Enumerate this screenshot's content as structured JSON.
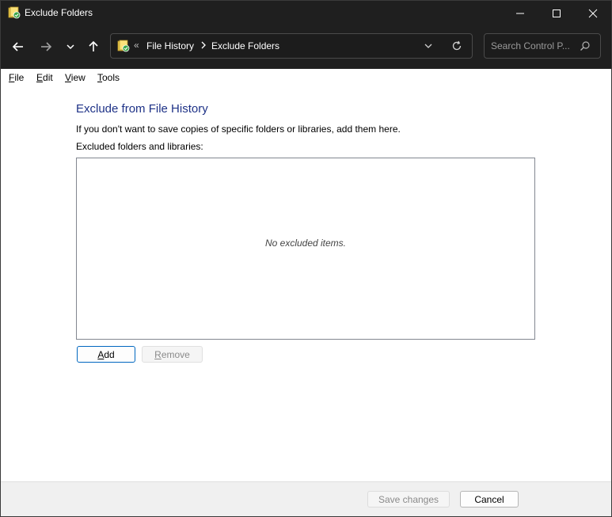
{
  "window": {
    "title": "Exclude Folders",
    "icon": "file-history-icon"
  },
  "navigation": {
    "back_icon": "arrow-left-icon",
    "forward_icon": "arrow-right-icon",
    "recent_icon": "chevron-down-icon",
    "up_icon": "arrow-up-icon",
    "overflow_chevron": "«",
    "breadcrumbs": [
      "File History",
      "Exclude Folders"
    ],
    "search_placeholder": "Search Control P..."
  },
  "menu": {
    "file": {
      "accel": "F",
      "rest": "ile"
    },
    "edit": {
      "accel": "E",
      "rest": "dit"
    },
    "view": {
      "accel": "V",
      "rest": "iew"
    },
    "tools": {
      "accel": "T",
      "rest": "ools"
    }
  },
  "main": {
    "heading": "Exclude from File History",
    "description": "If you don't want to save copies of specific folders or libraries, add them here.",
    "list_label": "Excluded folders and libraries:",
    "empty_text": "No excluded items.",
    "add_button": {
      "accel": "A",
      "rest": "dd"
    },
    "remove_button": {
      "accel": "R",
      "rest": "emove"
    }
  },
  "footer": {
    "save_label": "Save changes",
    "cancel_label": "Cancel"
  },
  "colors": {
    "titlebar": "#1f1f1f",
    "heading": "#1e3287",
    "accent": "#0067c0"
  }
}
